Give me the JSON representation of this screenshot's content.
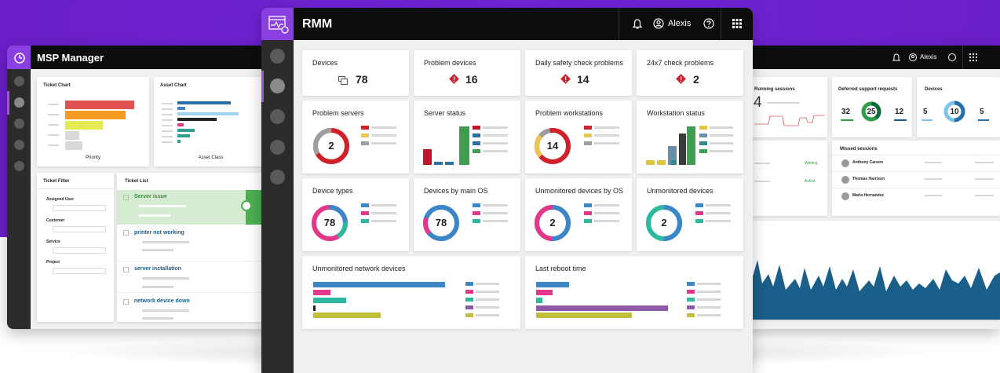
{
  "left_app": {
    "title": "MSP Manager",
    "ticket_chart": {
      "title": "Ticket Chart",
      "xlabel": "Priority",
      "colors": [
        "#e05252",
        "#f39c1f",
        "#e4ea54",
        "#d9d9d9",
        "#d9d9d9"
      ]
    },
    "asset_chart": {
      "title": "Asset Chart",
      "xlabel": "Asset Class",
      "colors": [
        "#2a6fa8",
        "#9fd3ef",
        "#222222",
        "#e3388a",
        "#2f9d8f",
        "#2f9d8f"
      ]
    },
    "ticket_filter": {
      "title": "Ticket Filter",
      "groups": [
        "Assigned User",
        "Customer",
        "Service",
        "Project"
      ]
    },
    "ticket_list": {
      "title": "Ticket List",
      "items": [
        "Server issue",
        "printer not working",
        "server installation",
        "network device down"
      ]
    }
  },
  "main_app": {
    "title": "RMM",
    "user": "Alexis",
    "tiles": {
      "devices": {
        "label": "Devices",
        "value": "78"
      },
      "problem_devices": {
        "label": "Problem devices",
        "value": "16"
      },
      "daily_safety": {
        "label": "Daily safety check problems",
        "value": "14"
      },
      "check_24x7": {
        "label": "24x7 check problems",
        "value": "2"
      }
    },
    "problem_servers": {
      "title": "Problem servers",
      "value": "2"
    },
    "server_status": {
      "title": "Server status"
    },
    "problem_workstations": {
      "title": "Problem workstations",
      "value": "14"
    },
    "workstation_status": {
      "title": "Workstation status"
    },
    "device_types": {
      "title": "Device types",
      "value": "78"
    },
    "devices_by_os": {
      "title": "Devices by main OS",
      "value": "78"
    },
    "unmonitored_by_os": {
      "title": "Unmonitored devices by OS",
      "value": "2"
    },
    "unmonitored_devices": {
      "title": "Unmonitored devices",
      "value": "2"
    },
    "unmonitored_network": {
      "title": "Unmonitored network devices"
    },
    "last_reboot": {
      "title": "Last reboot time"
    }
  },
  "right_app": {
    "user": "Alexis",
    "running_sessions": {
      "title": "Running sessions",
      "value": "4"
    },
    "deferred": {
      "title": "Deferred support requests",
      "values": [
        "32",
        "25",
        "12"
      ]
    },
    "devices": {
      "title": "Devices",
      "values": [
        "5",
        "10",
        "5"
      ]
    },
    "list_status": [
      "Waiting",
      "Active"
    ],
    "missed_sessions": {
      "title": "Missed sessions",
      "people": [
        "Anthony Carson",
        "Thomas Harrison",
        "Maria Hernandez"
      ]
    }
  },
  "colors": {
    "brand": "#6a1fc7",
    "red": "#d0202a",
    "green": "#3f9e4f",
    "blue": "#3a86c8",
    "pink": "#e3388a",
    "teal": "#2eb89e"
  }
}
